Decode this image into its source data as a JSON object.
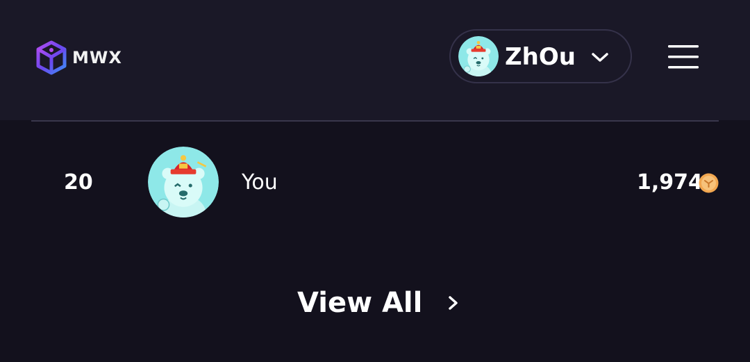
{
  "header": {
    "logo_text": "MWX",
    "user_pill": {
      "name": "ZhOu",
      "avatar_icon": "bear-avatar-icon",
      "chevron_icon": "chevron-down-icon"
    },
    "menu_icon": "hamburger-menu-icon"
  },
  "leaderboard": {
    "current_user_row": {
      "rank": "20",
      "avatar_icon": "bear-avatar-icon",
      "name": "You",
      "score": "1,974",
      "coin_icon": "coin-icon"
    },
    "view_all_label": "View All",
    "view_all_icon": "chevron-right-icon"
  },
  "colors": {
    "background": "#13111d",
    "header_background": "#1a1827",
    "pill_border": "#35324a",
    "avatar_bg": "#8ee8e8",
    "hat_red": "#d8232a",
    "coin": "#f2a750"
  }
}
